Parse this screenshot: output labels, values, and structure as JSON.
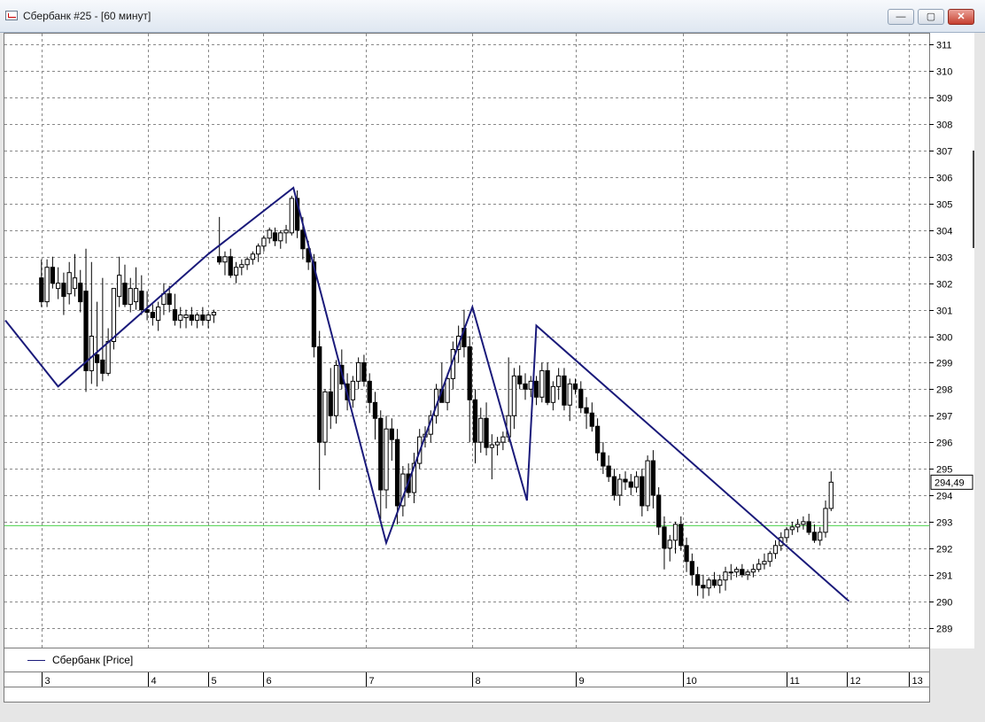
{
  "window": {
    "title": "Сбербанк #25 - [60 минут]",
    "minimize_label": "—",
    "maximize_label": "▢",
    "close_label": "✕"
  },
  "legend": {
    "label": "Сбербанк [Price]"
  },
  "colors": {
    "candle": "#000000",
    "wave_line": "#1a1a7a",
    "level_line": "#4cd24c",
    "grid": "#888888"
  },
  "chart_data": {
    "type": "candlestick",
    "title": "",
    "ylim": [
      288.5,
      311.5
    ],
    "y_ticks": [
      289,
      290,
      291,
      292,
      293,
      294,
      295,
      296,
      297,
      298,
      299,
      300,
      301,
      302,
      303,
      304,
      305,
      306,
      307,
      308,
      309,
      310,
      311
    ],
    "x_ticks": [
      {
        "label": "3",
        "pos": 0
      },
      {
        "label": "4",
        "pos": 19.2
      },
      {
        "label": "5",
        "pos": 30
      },
      {
        "label": "6",
        "pos": 39.9
      },
      {
        "label": "7",
        "pos": 58.4
      },
      {
        "label": "8",
        "pos": 77.5
      },
      {
        "label": "9",
        "pos": 96.1
      },
      {
        "label": "10",
        "pos": 115.3
      },
      {
        "label": "11",
        "pos": 134
      },
      {
        "label": "12",
        "pos": 144.8
      },
      {
        "label": "13",
        "pos": 155.9
      }
    ],
    "x_range": [
      -6.5,
      159
    ],
    "last_price_label": "294,49",
    "last_price": 294.49,
    "horizontal_level": 292.85,
    "wave_line": [
      [
        -6.5,
        300.6
      ],
      [
        3,
        298.1
      ],
      [
        30,
        303.1
      ],
      [
        45.3,
        305.6
      ],
      [
        62,
        292.2
      ],
      [
        77.5,
        301.1
      ],
      [
        87.3,
        293.8
      ],
      [
        89,
        300.4
      ],
      [
        145.2,
        290
      ]
    ],
    "candles": [
      [
        302.2,
        302.9,
        301.1,
        301.3
      ],
      [
        301.3,
        302.9,
        301.1,
        302.6
      ],
      [
        302.6,
        303.0,
        301.8,
        302.0
      ],
      [
        301.8,
        302.6,
        301.4,
        302.0
      ],
      [
        302.0,
        302.4,
        300.8,
        301.5
      ],
      [
        301.6,
        302.8,
        301.2,
        302.4
      ],
      [
        301.8,
        303.1,
        301.5,
        302.2
      ],
      [
        302.0,
        302.5,
        300.9,
        301.3
      ],
      [
        301.7,
        303.3,
        297.9,
        298.7
      ],
      [
        298.7,
        302.8,
        298.2,
        300.0
      ],
      [
        299.3,
        301.3,
        298.1,
        299.0
      ],
      [
        299.1,
        302.2,
        298.3,
        298.6
      ],
      [
        298.6,
        300.3,
        298.5,
        299.8
      ],
      [
        299.8,
        301.8,
        299.5,
        301.8
      ],
      [
        301.5,
        303.0,
        301.1,
        302.3
      ],
      [
        302.0,
        302.7,
        301.1,
        301.2
      ],
      [
        301.2,
        302.2,
        300.9,
        301.8
      ],
      [
        301.3,
        302.6,
        301.0,
        301.8
      ],
      [
        301.7,
        302.3,
        300.8,
        301.0
      ],
      [
        301.0,
        301.7,
        300.6,
        300.9
      ],
      [
        300.9,
        301.2,
        300.4,
        300.7
      ],
      [
        300.6,
        301.3,
        300.2,
        301.1
      ],
      [
        301.2,
        302.0,
        300.8,
        301.6
      ],
      [
        301.6,
        301.9,
        300.9,
        301.2
      ],
      [
        301.0,
        301.6,
        300.4,
        300.6
      ],
      [
        300.6,
        301.1,
        300.3,
        300.8
      ],
      [
        300.7,
        301.0,
        300.3,
        300.8
      ],
      [
        300.8,
        301.1,
        300.4,
        300.6
      ],
      [
        300.6,
        300.9,
        300.3,
        300.8
      ],
      [
        300.8,
        301.1,
        300.4,
        300.6
      ],
      [
        300.6,
        300.9,
        300.3,
        300.8
      ],
      [
        300.8,
        301.0,
        300.5,
        300.9
      ],
      [
        303.0,
        304.5,
        302.7,
        302.8
      ],
      [
        302.8,
        303.2,
        302.3,
        303.0
      ],
      [
        303.0,
        303.3,
        302.2,
        302.3
      ],
      [
        302.3,
        302.8,
        302.0,
        302.6
      ],
      [
        302.6,
        302.9,
        302.3,
        302.7
      ],
      [
        302.7,
        303.0,
        302.5,
        302.9
      ],
      [
        302.9,
        303.2,
        302.7,
        303.1
      ],
      [
        303.1,
        303.5,
        302.8,
        303.4
      ],
      [
        303.4,
        303.8,
        303.2,
        303.7
      ],
      [
        303.7,
        304.1,
        303.5,
        304.0
      ],
      [
        303.9,
        304.1,
        303.4,
        303.6
      ],
      [
        303.6,
        304.0,
        303.3,
        303.9
      ],
      [
        303.9,
        304.2,
        303.5,
        304.0
      ],
      [
        303.9,
        305.3,
        303.8,
        305.2
      ],
      [
        305.2,
        305.5,
        303.7,
        304.0
      ],
      [
        304.0,
        304.5,
        302.9,
        303.3
      ],
      [
        303.3,
        303.6,
        302.5,
        302.8
      ],
      [
        302.8,
        303.1,
        299.2,
        299.6
      ],
      [
        299.6,
        300.2,
        294.2,
        296.0
      ],
      [
        296.0,
        298.0,
        295.5,
        297.9
      ],
      [
        297.9,
        298.8,
        296.5,
        297.0
      ],
      [
        297.0,
        299.1,
        296.7,
        298.9
      ],
      [
        298.9,
        299.5,
        298.0,
        298.2
      ],
      [
        298.2,
        298.6,
        297.2,
        297.6
      ],
      [
        297.6,
        298.5,
        297.3,
        298.3
      ],
      [
        298.3,
        299.2,
        298.0,
        299.0
      ],
      [
        299.0,
        299.3,
        298.1,
        298.3
      ],
      [
        298.3,
        298.6,
        297.1,
        297.5
      ],
      [
        297.5,
        297.9,
        296.1,
        296.9
      ],
      [
        296.9,
        297.2,
        293.1,
        294.2
      ],
      [
        294.2,
        297.0,
        293.5,
        296.5
      ],
      [
        296.5,
        296.9,
        295.3,
        296.1
      ],
      [
        296.1,
        296.5,
        292.9,
        293.6
      ],
      [
        293.6,
        295.1,
        293.2,
        294.8
      ],
      [
        294.8,
        295.2,
        293.9,
        294.1
      ],
      [
        294.1,
        295.6,
        293.7,
        295.2
      ],
      [
        295.2,
        296.5,
        295.0,
        296.2
      ],
      [
        296.2,
        296.6,
        295.8,
        296.3
      ],
      [
        296.3,
        297.2,
        296.0,
        297.0
      ],
      [
        297.0,
        298.2,
        296.7,
        298.0
      ],
      [
        298.0,
        299.0,
        297.5,
        297.5
      ],
      [
        297.5,
        298.6,
        297.2,
        298.4
      ],
      [
        298.4,
        299.8,
        298.0,
        299.5
      ],
      [
        299.5,
        300.4,
        299.0,
        300.0
      ],
      [
        300.3,
        301.0,
        299.2,
        299.6
      ],
      [
        299.6,
        300.0,
        296.0,
        297.6
      ],
      [
        297.6,
        298.0,
        295.2,
        296.0
      ],
      [
        296.0,
        297.3,
        295.6,
        296.9
      ],
      [
        296.9,
        297.5,
        295.5,
        295.8
      ],
      [
        295.8,
        296.3,
        294.6,
        295.9
      ],
      [
        295.9,
        296.2,
        295.5,
        296.0
      ],
      [
        296.0,
        296.4,
        295.7,
        296.2
      ],
      [
        296.2,
        299.2,
        296.0,
        297.0
      ],
      [
        297.0,
        298.8,
        296.5,
        298.5
      ],
      [
        298.5,
        298.9,
        298.0,
        298.2
      ],
      [
        298.2,
        298.6,
        297.6,
        298.0
      ],
      [
        298.0,
        298.5,
        297.7,
        298.3
      ],
      [
        298.3,
        298.5,
        297.4,
        297.7
      ],
      [
        297.7,
        299.0,
        297.5,
        298.7
      ],
      [
        298.7,
        299.0,
        297.4,
        297.5
      ],
      [
        297.5,
        298.3,
        297.2,
        298.1
      ],
      [
        298.1,
        298.8,
        297.6,
        298.5
      ],
      [
        298.5,
        298.8,
        297.2,
        297.4
      ],
      [
        297.4,
        298.4,
        296.8,
        298.2
      ],
      [
        298.2,
        298.4,
        297.8,
        298.0
      ],
      [
        298.0,
        298.3,
        297.1,
        297.3
      ],
      [
        297.3,
        297.7,
        296.5,
        297.1
      ],
      [
        297.1,
        297.5,
        296.4,
        296.6
      ],
      [
        296.6,
        296.9,
        295.3,
        295.6
      ],
      [
        295.6,
        296.0,
        294.8,
        295.1
      ],
      [
        295.1,
        295.5,
        294.5,
        294.7
      ],
      [
        294.7,
        295.0,
        293.8,
        294.0
      ],
      [
        294.0,
        294.8,
        293.6,
        294.6
      ],
      [
        294.6,
        294.9,
        294.2,
        294.5
      ],
      [
        294.5,
        294.8,
        294.0,
        294.3
      ],
      [
        294.3,
        294.9,
        294.1,
        294.7
      ],
      [
        294.7,
        295.0,
        293.2,
        293.6
      ],
      [
        293.6,
        295.5,
        293.4,
        295.3
      ],
      [
        295.3,
        295.7,
        293.5,
        294.0
      ],
      [
        294.0,
        294.3,
        292.5,
        292.8
      ],
      [
        292.8,
        293.2,
        291.2,
        292.0
      ],
      [
        292.0,
        292.5,
        291.5,
        292.3
      ],
      [
        292.3,
        293.0,
        291.8,
        292.9
      ],
      [
        292.9,
        293.2,
        291.9,
        292.1
      ],
      [
        292.1,
        292.4,
        291.1,
        291.5
      ],
      [
        291.5,
        291.8,
        290.6,
        291.0
      ],
      [
        291.0,
        291.3,
        290.2,
        290.6
      ],
      [
        290.6,
        291.0,
        290.1,
        290.5
      ],
      [
        290.5,
        290.9,
        290.2,
        290.8
      ],
      [
        290.8,
        291.1,
        290.5,
        290.6
      ],
      [
        290.6,
        291.0,
        290.3,
        290.8
      ],
      [
        290.8,
        291.3,
        290.4,
        291.1
      ],
      [
        291.1,
        291.4,
        290.8,
        291.1
      ],
      [
        291.1,
        291.3,
        290.9,
        291.2
      ],
      [
        291.2,
        291.4,
        290.9,
        291.0
      ],
      [
        291.0,
        291.2,
        290.8,
        291.1
      ],
      [
        291.1,
        291.4,
        290.9,
        291.2
      ],
      [
        291.2,
        291.6,
        291.1,
        291.4
      ],
      [
        291.4,
        291.8,
        291.2,
        291.5
      ],
      [
        291.5,
        291.9,
        291.3,
        291.8
      ],
      [
        291.8,
        292.3,
        291.6,
        292.1
      ],
      [
        292.1,
        292.6,
        291.9,
        292.4
      ],
      [
        292.4,
        292.8,
        292.2,
        292.7
      ],
      [
        292.7,
        293.0,
        292.5,
        292.8
      ],
      [
        292.8,
        293.1,
        292.6,
        292.9
      ],
      [
        292.9,
        293.2,
        292.7,
        293.0
      ],
      [
        293.0,
        293.3,
        292.5,
        292.6
      ],
      [
        292.6,
        292.9,
        292.2,
        292.3
      ],
      [
        292.3,
        292.8,
        292.1,
        292.6
      ],
      [
        292.6,
        293.8,
        292.4,
        293.5
      ],
      [
        293.5,
        294.9,
        293.4,
        294.49
      ]
    ]
  }
}
